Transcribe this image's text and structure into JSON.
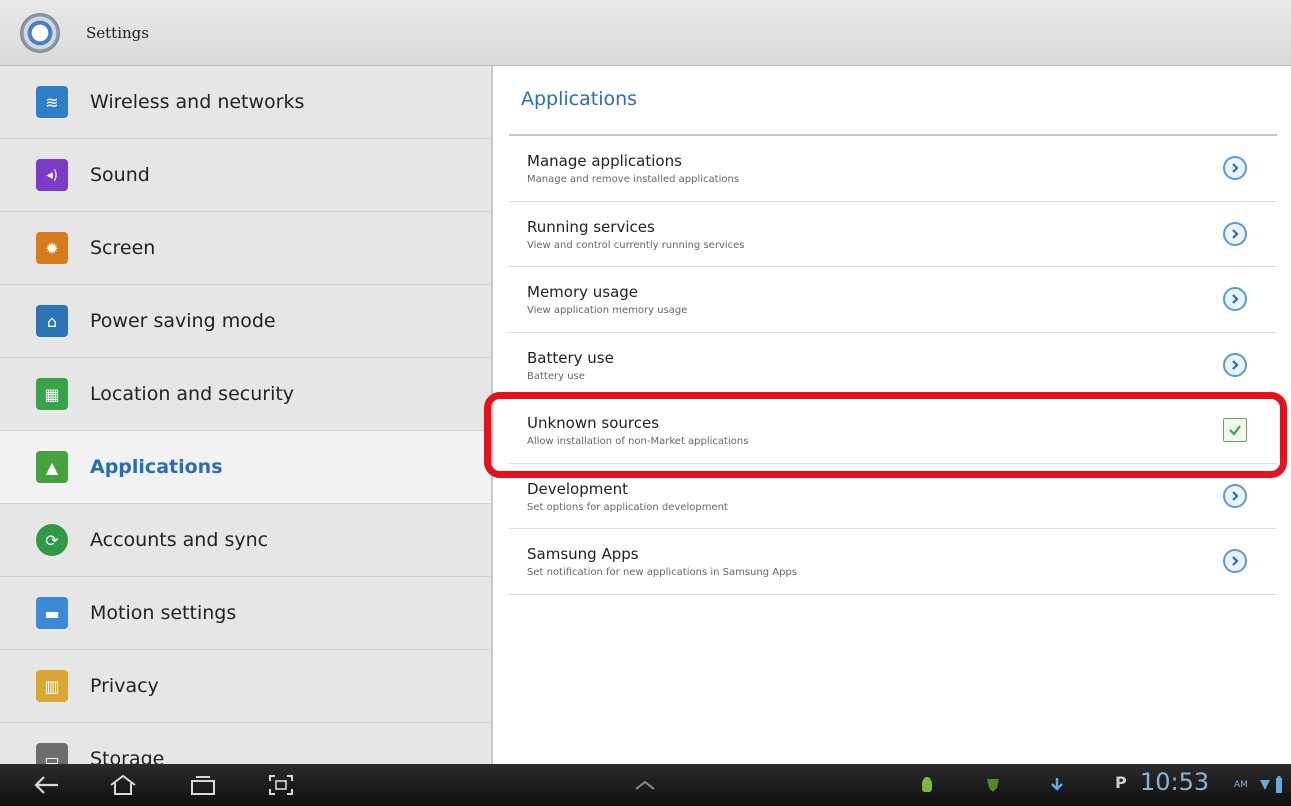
{
  "titlebar": {
    "title": "Settings"
  },
  "sidebar": {
    "items": [
      {
        "label": "Wireless and networks",
        "icon": "wifi-icon",
        "color": "#2e7fc7",
        "glyph": "≋"
      },
      {
        "label": "Sound",
        "icon": "speaker-icon",
        "color": "#7a3cc5",
        "glyph": "◂)"
      },
      {
        "label": "Screen",
        "icon": "brightness-icon",
        "color": "#d67a1c",
        "glyph": "✹"
      },
      {
        "label": "Power saving mode",
        "icon": "battery-saver-icon",
        "color": "#2c74b8",
        "glyph": "⌂"
      },
      {
        "label": "Location and security",
        "icon": "grid-security-icon",
        "color": "#3aa34a",
        "glyph": "▦"
      },
      {
        "label": "Applications",
        "icon": "applications-icon",
        "color": "#45a23d",
        "glyph": "▲"
      },
      {
        "label": "Accounts and sync",
        "icon": "sync-icon",
        "color": "#2f9a45",
        "glyph": "⟳"
      },
      {
        "label": "Motion settings",
        "icon": "motion-icon",
        "color": "#3c8ad6",
        "glyph": "▬"
      },
      {
        "label": "Privacy",
        "icon": "privacy-icon",
        "color": "#d8a832",
        "glyph": "▥"
      },
      {
        "label": "Storage",
        "icon": "storage-icon",
        "color": "#6d6d6d",
        "glyph": "▭"
      }
    ],
    "active_index": 5
  },
  "main": {
    "section_title": "Applications",
    "rows": [
      {
        "title": "Manage applications",
        "subtitle": "Manage and remove installed applications",
        "control": "chevron"
      },
      {
        "title": "Running services",
        "subtitle": "View and control currently running services",
        "control": "chevron"
      },
      {
        "title": "Memory usage",
        "subtitle": "View application memory usage",
        "control": "chevron"
      },
      {
        "title": "Battery use",
        "subtitle": "Battery use",
        "control": "chevron"
      },
      {
        "title": "Unknown sources",
        "subtitle": "Allow installation of non-Market applications",
        "control": "checkbox",
        "checked": true
      },
      {
        "title": "Development",
        "subtitle": "Set options for application development",
        "control": "chevron"
      },
      {
        "title": "Samsung Apps",
        "subtitle": "Set notification for new applications in Samsung Apps",
        "control": "chevron"
      }
    ]
  },
  "status": {
    "time": "10:53",
    "ampm": "AM",
    "p_label": "P"
  },
  "colors": {
    "accent": "#2a6db5",
    "highlight": "#e4121c",
    "chevron": "#5a9ad8"
  }
}
